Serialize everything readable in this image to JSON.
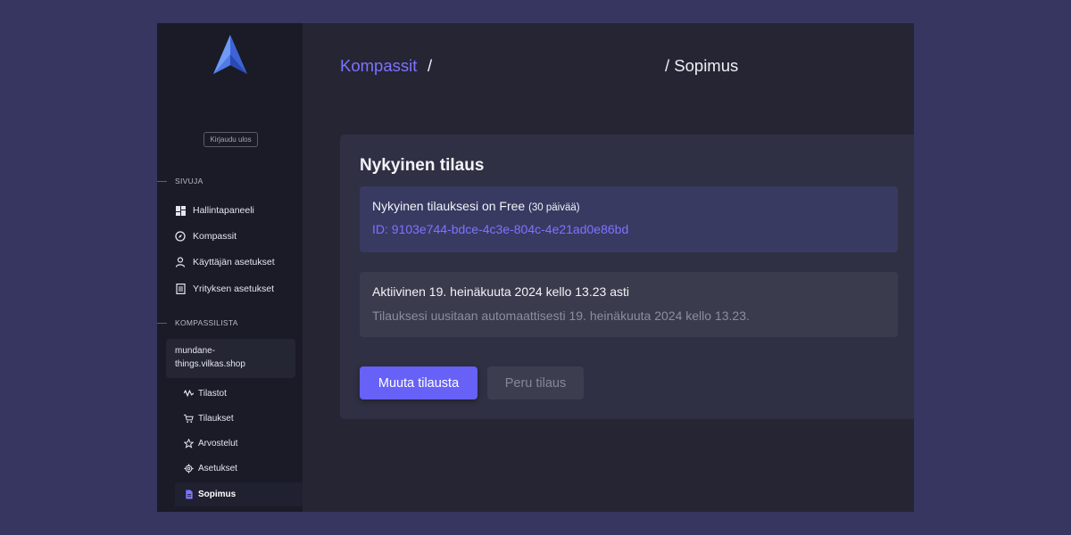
{
  "sidebar": {
    "logo": "compass-logo",
    "logout_label": "Kirjaudu ulos",
    "section_pages": "SIVUJA",
    "nav": [
      {
        "label": "Hallintapaneeli",
        "icon": "dashboard-icon"
      },
      {
        "label": "Kompassit",
        "icon": "compass-icon"
      },
      {
        "label": "Käyttäjän asetukset",
        "icon": "user-icon"
      },
      {
        "label": "Yrityksen asetukset",
        "icon": "document-icon"
      }
    ],
    "section_compasses": "KOMPASSILISTA",
    "compass_name_1": "mundane-",
    "compass_name_2": "things.vilkas.shop",
    "sub_nav": [
      {
        "label": "Tilastot",
        "icon": "activity-icon"
      },
      {
        "label": "Tilaukset",
        "icon": "cart-icon"
      },
      {
        "label": "Arvostelut",
        "icon": "star-icon"
      },
      {
        "label": "Asetukset",
        "icon": "gear-icon"
      },
      {
        "label": "Sopimus",
        "icon": "file-icon",
        "active": true
      }
    ]
  },
  "breadcrumb": {
    "link": "Kompassit",
    "separator": "/",
    "current": "/ Sopimus"
  },
  "subscription": {
    "title": "Nykyinen tilaus",
    "plan_text": "Nykyinen tilauksesi on Free",
    "plan_days": "(30 päivää)",
    "plan_id": "ID: 9103e744-bdce-4c3e-804c-4e21ad0e86bd",
    "active_text": "Aktiivinen 19. heinäkuuta 2024 kello 13.23 asti",
    "renew_text": "Tilauksesi uusitaan automaattisesti 19. heinäkuuta 2024 kello 13.23.",
    "change_button": "Muuta tilausta",
    "cancel_button": "Peru tilaus"
  },
  "colors": {
    "accent": "#6761f7",
    "link": "#7c74ff",
    "background": "#363660",
    "sidebar": "#1a1b27",
    "main": "#252534"
  }
}
